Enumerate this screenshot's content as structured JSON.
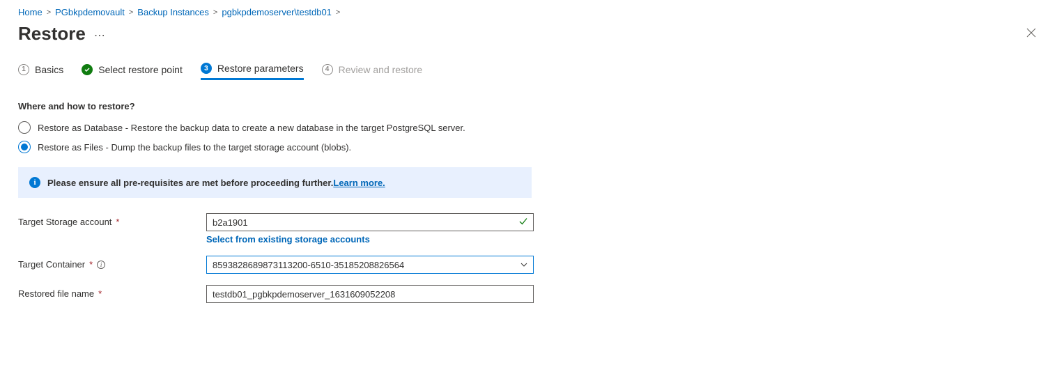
{
  "breadcrumb": {
    "items": [
      "Home",
      "PGbkpdemovault",
      "Backup Instances",
      "pgbkpdemoserver\\testdb01"
    ],
    "sep": ">"
  },
  "header": {
    "title": "Restore"
  },
  "tabs": [
    {
      "num": "1",
      "label": "Basics",
      "state": "empty"
    },
    {
      "num": "",
      "label": "Select restore point",
      "state": "check"
    },
    {
      "num": "3",
      "label": "Restore parameters",
      "state": "active"
    },
    {
      "num": "4",
      "label": "Review and restore",
      "state": "disabled"
    }
  ],
  "section": {
    "heading": "Where and how to restore?",
    "radios": [
      {
        "label": "Restore as Database - Restore the backup data to create a new database in the target PostgreSQL server.",
        "selected": false
      },
      {
        "label": "Restore as Files - Dump the backup files to the target storage account (blobs).",
        "selected": true
      }
    ]
  },
  "info": {
    "message": "Please ensure all pre-requisites are met before proceeding further.",
    "link": "Learn more."
  },
  "form": {
    "storage": {
      "label": "Target Storage account",
      "value": "b2a1901",
      "below_link": "Select from existing storage accounts"
    },
    "container": {
      "label": "Target Container",
      "value": "8593828689873113200-6510-35185208826564"
    },
    "filename": {
      "label": "Restored file name",
      "value": "testdb01_pgbkpdemoserver_1631609052208"
    }
  }
}
